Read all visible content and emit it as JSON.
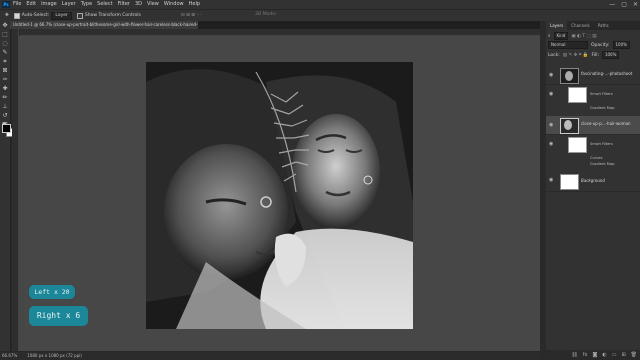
{
  "menubar": {
    "app_icon": "Ps",
    "items": [
      "File",
      "Edit",
      "Image",
      "Layer",
      "Type",
      "Select",
      "Filter",
      "3D",
      "View",
      "Window",
      "Help"
    ],
    "window_controls": [
      "—",
      "▢",
      "✕"
    ]
  },
  "options": {
    "auto_select_label": "Auto-Select:",
    "auto_select_value": "Layer",
    "transform_label": "Show Transform Controls",
    "mode_3d": "3D Mode:"
  },
  "document": {
    "tab_title": "Untitled-1 @ 66.7% (close-up-portrait-blithesome-girl-with-flower-hair-careless-black-haired-white-woman, RGB/8#) *"
  },
  "status": {
    "zoom": "66.67%",
    "doc_size": "1080 px x 1080 px (72 ppi)"
  },
  "layers_panel": {
    "tabs": [
      "Layers",
      "Channels",
      "Paths"
    ],
    "kind_label": "Kind",
    "blend_mode": "Normal",
    "opacity_label": "Opacity:",
    "opacity_value": "100%",
    "lock_label": "Lock:",
    "fill_label": "Fill:",
    "fill_value": "100%",
    "layers": [
      {
        "name": "fascinating-...-photoshoot",
        "sub": [
          "Smart Filters",
          "Gradient Map"
        ]
      },
      {
        "name": "close-up-p...-hair-woman",
        "sub": [
          "Smart Filters",
          "Curves",
          "Gradient Map"
        ]
      },
      {
        "name": "Background"
      }
    ]
  },
  "keycast": {
    "left": "Left x 20",
    "right": "Right x 6"
  },
  "colors": {
    "badge": "#1b8799",
    "workspace": "#474747"
  }
}
